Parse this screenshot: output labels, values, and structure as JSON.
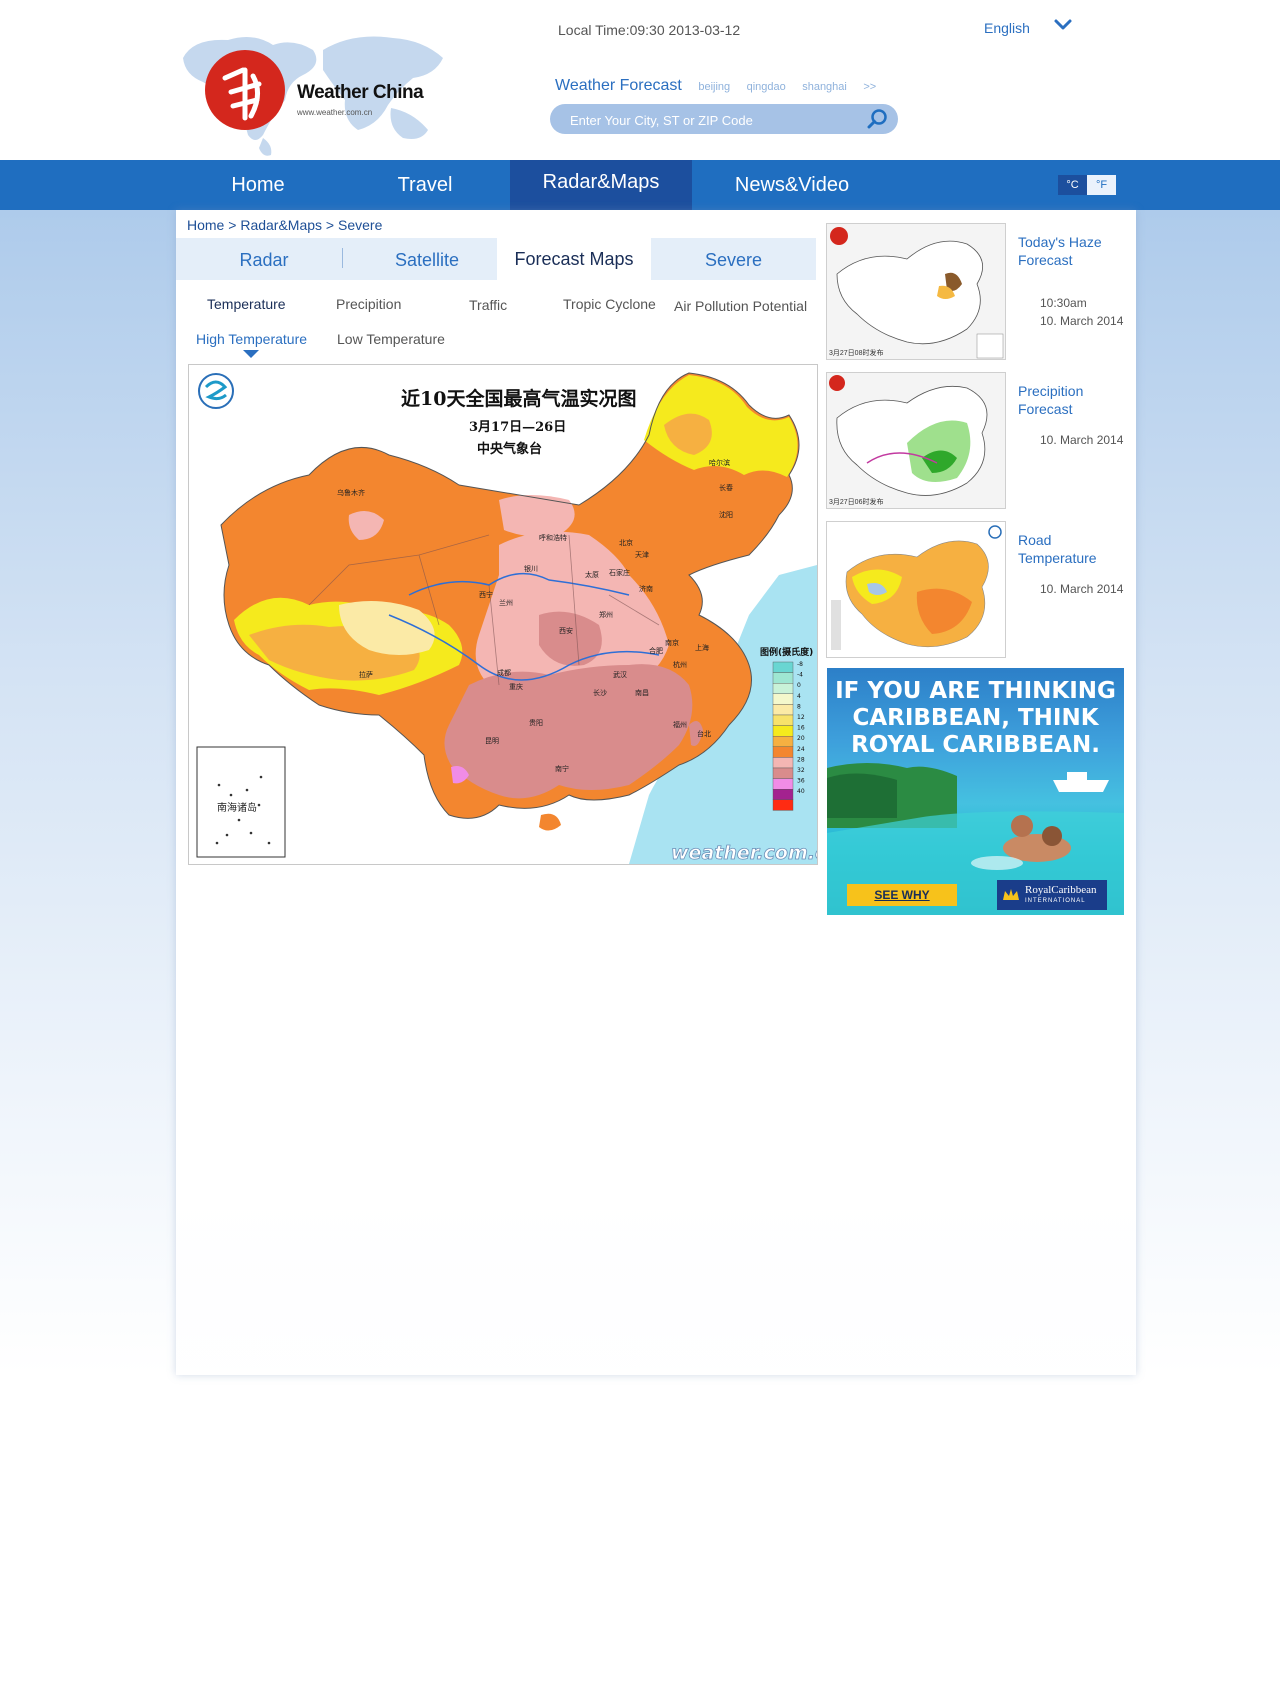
{
  "header": {
    "logo_text": "Weather China",
    "logo_url": "www.weather.com.cn",
    "local_time": "Local Time:09:30  2013-03-12",
    "language": "English",
    "weather_forecast_label": "Weather Forecast",
    "quick_cities": [
      "beijing",
      "qingdao",
      "shanghai",
      ">>"
    ],
    "search_placeholder": "Enter Your City, ST or ZIP Code"
  },
  "nav": {
    "items": [
      {
        "label": "Home"
      },
      {
        "label": "Travel"
      },
      {
        "label": "Radar&Maps"
      },
      {
        "label": "News&Video"
      }
    ],
    "active": "Radar&Maps",
    "units": [
      "°C",
      "°F"
    ]
  },
  "breadcrumb": [
    "Home",
    "Radar&Maps",
    "Severe"
  ],
  "tabs": {
    "items": [
      {
        "label": "Radar"
      },
      {
        "label": "Satellite"
      },
      {
        "label": "Forecast Maps"
      },
      {
        "label": "Severe"
      }
    ],
    "active": "Forecast Maps"
  },
  "subtabs": {
    "items": [
      {
        "label": "Temperature"
      },
      {
        "label": "Precipition"
      },
      {
        "label": "Traffic"
      },
      {
        "label": "Tropic Cyclone"
      },
      {
        "label": "Air Pollution Potential"
      }
    ],
    "active": "Temperature"
  },
  "subsubtabs": {
    "items": [
      {
        "label": "High Temperature"
      },
      {
        "label": "Low Temperature"
      }
    ],
    "active": "High Temperature"
  },
  "map": {
    "title": "近10天全国最高气温实况图",
    "date_range": "3月17日—26日",
    "source": "中央气象台",
    "legend_title": "图例(摄氏度)",
    "legend": [
      {
        "label": "-8",
        "color": "#69d6d2"
      },
      {
        "label": "-4",
        "color": "#9ee6d2"
      },
      {
        "label": "0",
        "color": "#c9f2d8"
      },
      {
        "label": "4",
        "color": "#f4f8cc"
      },
      {
        "label": "8",
        "color": "#fbeaa6"
      },
      {
        "label": "12",
        "color": "#f7e26a"
      },
      {
        "label": "16",
        "color": "#f5ea1d"
      },
      {
        "label": "20",
        "color": "#f6b041"
      },
      {
        "label": "24",
        "color": "#f3862f"
      },
      {
        "label": "28",
        "color": "#f4b6b3"
      },
      {
        "label": "32",
        "color": "#d98c8c"
      },
      {
        "label": "36",
        "color": "#f08ce6"
      },
      {
        "label": "40",
        "color": "#a3228f"
      },
      {
        "label": "",
        "color": "#ff2b12"
      }
    ],
    "inset_label": "南海诸岛",
    "watermark": "weather.com.cn",
    "region_colors": {
      "ocean": "#a9e3f2",
      "orange": "#f3862f",
      "light_orange": "#f6b041",
      "yellow": "#f5ea1d",
      "light_yellow": "#fbeaa6",
      "pink": "#f4b6b3",
      "mauve": "#d98c8c",
      "magenta": "#f08ce6"
    },
    "cities": [
      "乌鲁木齐",
      "呼和浩特",
      "哈尔滨",
      "长春",
      "沈阳",
      "北京",
      "天津",
      "石家庄",
      "太原",
      "银川",
      "西宁",
      "兰州",
      "济南",
      "郑州",
      "西安",
      "合肥",
      "南京",
      "上海",
      "杭州",
      "武汉",
      "成都",
      "重庆",
      "长沙",
      "南昌",
      "福州",
      "贵阳",
      "昆明",
      "南宁",
      "拉萨",
      "台北"
    ]
  },
  "sidebar": {
    "items": [
      {
        "title": "Today's Haze Forecast",
        "time": "10:30am",
        "date": "10. March 2014",
        "thumb_caption": "3月27日08时发布"
      },
      {
        "title": "Precipition Forecast",
        "time": "",
        "date": "10. March 2014",
        "thumb_caption": "3月27日06时发布"
      },
      {
        "title": "Road Temperature",
        "time": "",
        "date": "10. March 2014",
        "thumb_caption": ""
      }
    ]
  },
  "ad": {
    "headline": "IF YOU ARE THINKING CARIBBEAN, THINK ROYAL CARIBBEAN.",
    "cta": "SEE WHY",
    "brand": "RoyalCaribbean",
    "brand_sub": "INTERNATIONAL"
  },
  "colors": {
    "nav_blue": "#1f6ec0",
    "nav_active": "#1c4f9e",
    "link_blue": "#2b6fc0",
    "breadcrumb_blue": "#1e4f96"
  }
}
